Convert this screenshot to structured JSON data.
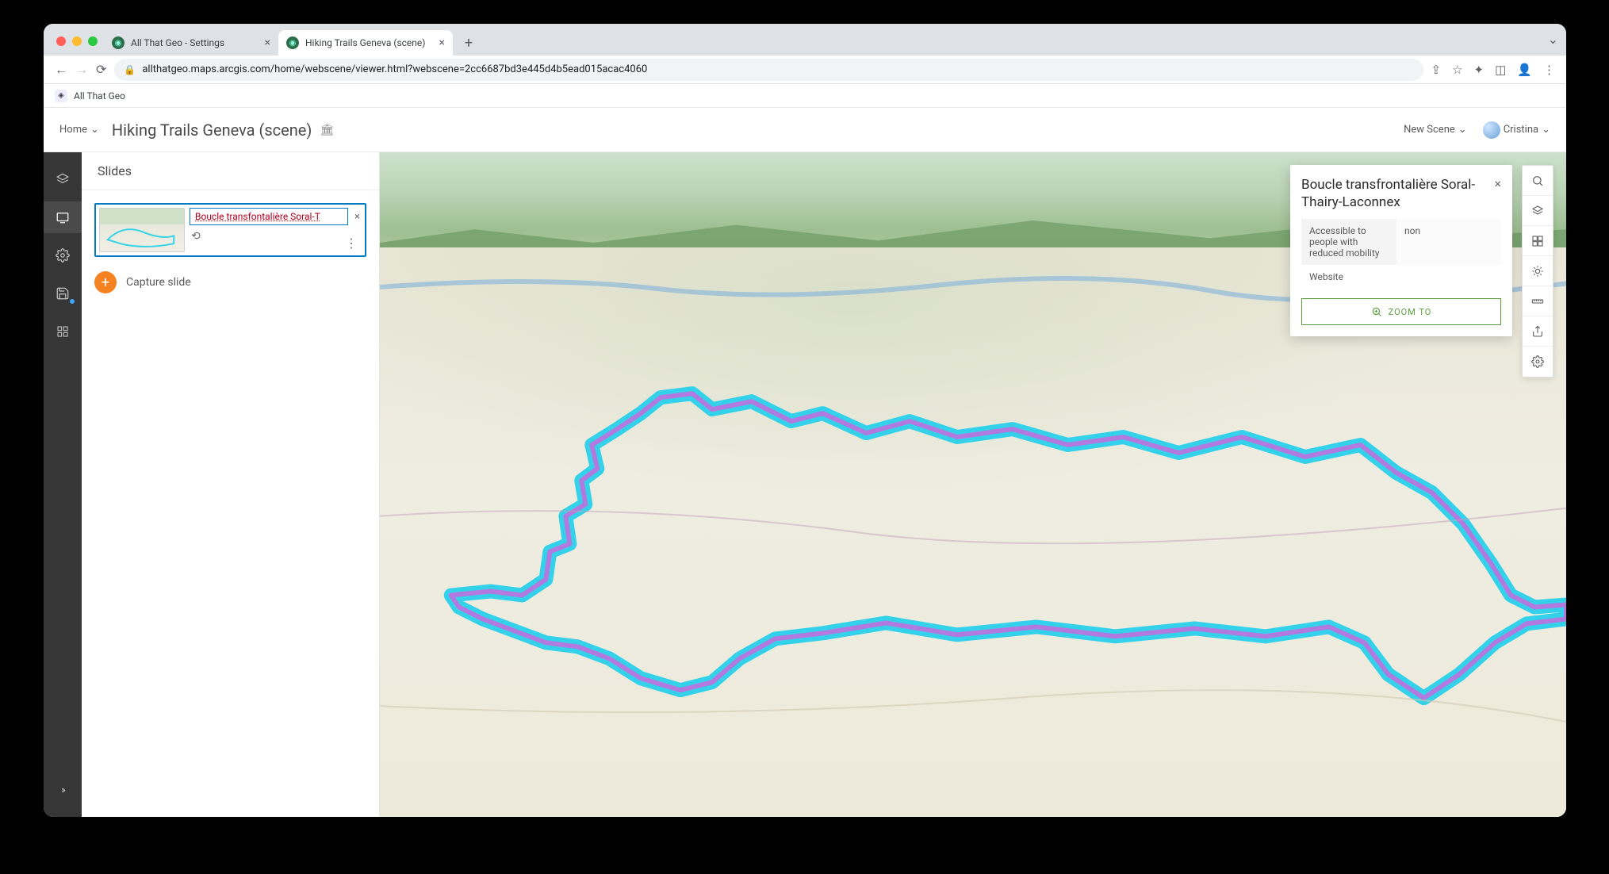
{
  "browser": {
    "tabs": [
      {
        "title": "All That Geo - Settings",
        "active": false
      },
      {
        "title": "Hiking Trails Geneva (scene)",
        "active": true
      }
    ],
    "url": "allthatgeo.maps.arcgis.com/home/webscene/viewer.html?webscene=2cc6687bd3e445d4b5ead015acac4060",
    "bookmark": "All That Geo"
  },
  "header": {
    "home": "Home",
    "scene_title": "Hiking Trails Geneva (scene)",
    "new_scene": "New Scene",
    "user": "Cristina"
  },
  "panel": {
    "title": "Slides",
    "slide_input": "Boucle transfontalière Soral-T",
    "capture": "Capture slide"
  },
  "popup": {
    "title": "Boucle transfrontalière Soral-Thairy-Laconnex",
    "rows": [
      {
        "label": "Accessible to people with reduced mobility",
        "value": "non"
      },
      {
        "label": "Website",
        "value": ""
      }
    ],
    "zoom": "ZOOM TO"
  },
  "right_tools": [
    "search",
    "layers",
    "basemap",
    "daylight",
    "measure",
    "share",
    "settings"
  ]
}
